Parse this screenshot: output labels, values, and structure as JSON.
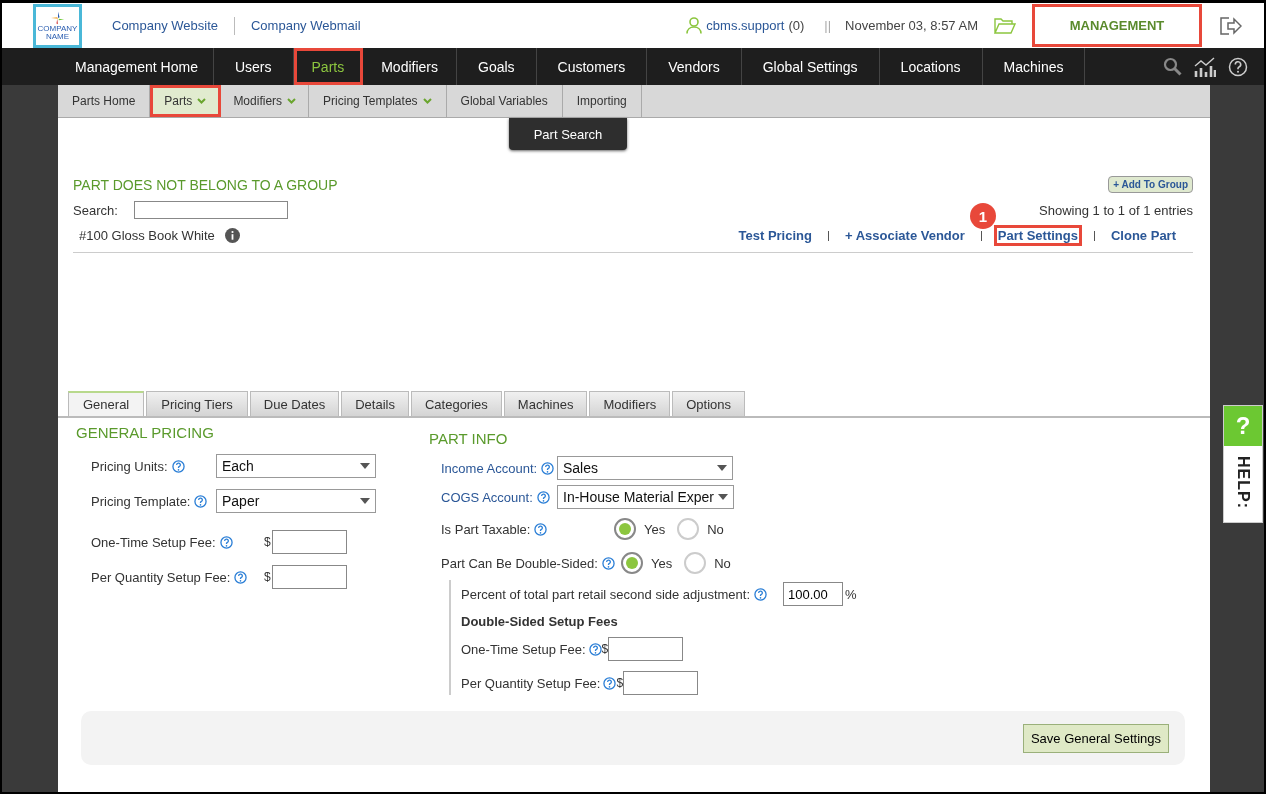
{
  "header": {
    "logo_text": [
      "COMPANY",
      "NAME"
    ],
    "links": [
      "Company Website",
      "Company Webmail"
    ],
    "user": "cbms.support",
    "count": "(0)",
    "separator": "||",
    "datetime": "November 03, 8:57 AM",
    "mode_button": {
      "label": "MANAGEMENT",
      "highlighted": true
    }
  },
  "nav": [
    {
      "label": "Management Home",
      "selected": false,
      "highlighted": false
    },
    {
      "label": "Users",
      "selected": false,
      "highlighted": false
    },
    {
      "label": "Parts",
      "selected": true,
      "highlighted": true
    },
    {
      "label": "Modifiers",
      "selected": false,
      "highlighted": false
    },
    {
      "label": "Goals",
      "selected": false,
      "highlighted": false
    },
    {
      "label": "Customers",
      "selected": false,
      "highlighted": false
    },
    {
      "label": "Vendors",
      "selected": false,
      "highlighted": false
    },
    {
      "label": "Global Settings",
      "selected": false,
      "highlighted": false
    },
    {
      "label": "Locations",
      "selected": false,
      "highlighted": false
    },
    {
      "label": "Machines",
      "selected": false,
      "highlighted": false
    }
  ],
  "subnav": [
    {
      "label": "Parts Home",
      "dropdown": false,
      "selected": false,
      "highlighted": false
    },
    {
      "label": "Parts",
      "dropdown": true,
      "selected": true,
      "highlighted": true
    },
    {
      "label": "Modifiers",
      "dropdown": true,
      "selected": false,
      "highlighted": false
    },
    {
      "label": "Pricing Templates",
      "dropdown": true,
      "selected": false,
      "highlighted": false
    },
    {
      "label": "Global Variables",
      "dropdown": false,
      "selected": false,
      "highlighted": false
    },
    {
      "label": "Importing",
      "dropdown": false,
      "selected": false,
      "highlighted": false
    }
  ],
  "dropdown_menu": [
    "Part Search"
  ],
  "group_title": "PART DOES NOT BELONG TO A GROUP",
  "add_group_button": "+ Add To Group",
  "search": {
    "label": "Search:"
  },
  "entries_info": "Showing 1 to 1 of 1 entries",
  "part": {
    "name": "#100 Gloss Book White",
    "actions": [
      {
        "label": "Test Pricing",
        "highlighted": false
      },
      {
        "label": "+ Associate Vendor",
        "highlighted": false
      },
      {
        "label": "Part Settings",
        "highlighted": true,
        "callout": "1"
      },
      {
        "label": "Clone Part",
        "highlighted": false
      }
    ]
  },
  "tabs": [
    {
      "label": "General",
      "selected": true
    },
    {
      "label": "Pricing Tiers",
      "selected": false
    },
    {
      "label": "Due Dates",
      "selected": false
    },
    {
      "label": "Details",
      "selected": false
    },
    {
      "label": "Categories",
      "selected": false
    },
    {
      "label": "Machines",
      "selected": false
    },
    {
      "label": "Modifiers",
      "selected": false
    },
    {
      "label": "Options",
      "selected": false
    }
  ],
  "general_pricing": {
    "title": "GENERAL PRICING",
    "fields": [
      {
        "kind": "select",
        "label": "Pricing Units:",
        "value": "Each"
      },
      {
        "kind": "select",
        "label": "Pricing Template:",
        "value": "Paper"
      },
      {
        "kind": "money",
        "label": "One-Time Setup Fee:",
        "currency": "$"
      },
      {
        "kind": "money",
        "label": "Per Quantity Setup Fee:",
        "currency": "$"
      }
    ]
  },
  "part_info": {
    "title": "PART INFO",
    "fields": [
      {
        "kind": "select",
        "label": "Income Account:",
        "value": "Sales"
      },
      {
        "kind": "select",
        "label": "COGS Account:",
        "value": "In-House Material Exper"
      },
      {
        "kind": "radio",
        "label": "Is Part Taxable:",
        "options": [
          {
            "label": "Yes",
            "selected": true
          },
          {
            "label": "No",
            "selected": false
          }
        ]
      },
      {
        "kind": "radio",
        "label": "Part Can Be Double-Sided:",
        "options": [
          {
            "label": "Yes",
            "selected": true
          },
          {
            "label": "No",
            "selected": false
          }
        ]
      }
    ]
  },
  "double_sided": {
    "percent_label": "Percent of total part retail second side adjustment:",
    "percent_value": "100.00",
    "unit": "%",
    "fees_title": "Double-Sided Setup Fees",
    "fees": [
      {
        "label": "One-Time Setup Fee:",
        "currency": "$"
      },
      {
        "label": "Per Quantity Setup Fee:",
        "currency": "$"
      }
    ]
  },
  "save_button": "Save General Settings",
  "help": {
    "icon": "?",
    "label": "HELP:"
  }
}
